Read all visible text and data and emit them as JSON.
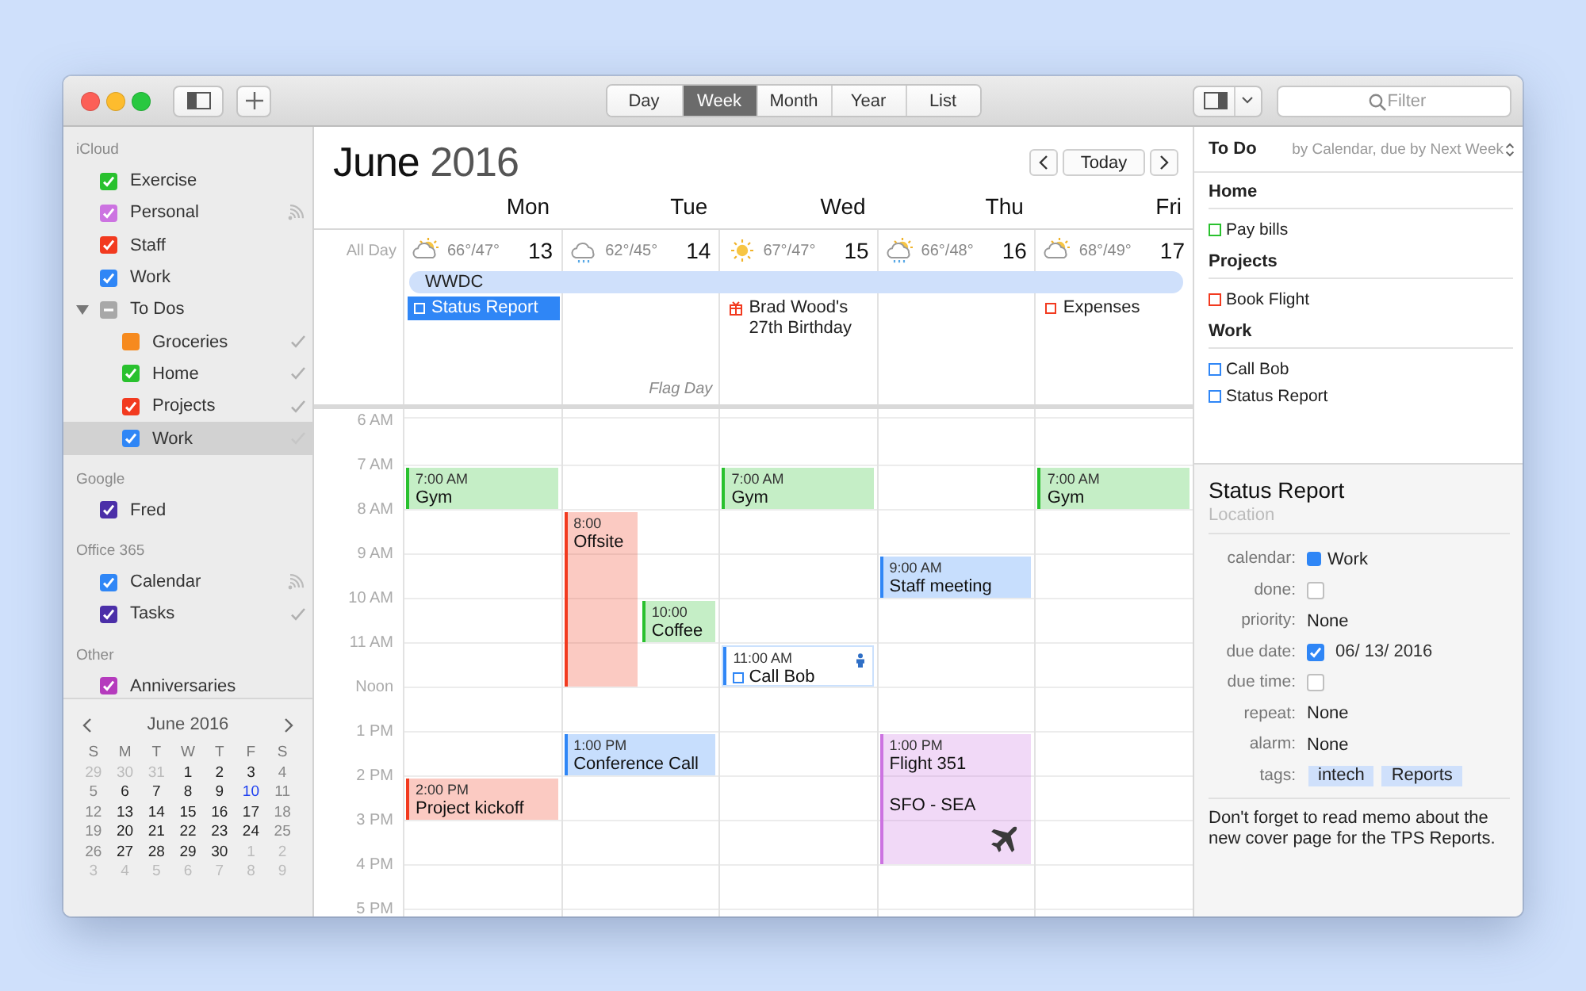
{
  "toolbar": {
    "view_tabs": [
      {
        "label": "Day",
        "selected": false
      },
      {
        "label": "Week",
        "selected": true
      },
      {
        "label": "Month",
        "selected": false
      },
      {
        "label": "Year",
        "selected": false
      },
      {
        "label": "List",
        "selected": false
      }
    ],
    "filter": {
      "placeholder": "Filter"
    }
  },
  "sidebar": {
    "sections": [
      {
        "title": "iCloud",
        "items": [
          {
            "label": "Exercise",
            "kind": "calendar",
            "color": "#29c12e",
            "checked": true,
            "selected": false,
            "shared": false,
            "completed_shown": false
          },
          {
            "label": "Personal",
            "kind": "calendar",
            "color": "#cc73e1",
            "checked": true,
            "selected": false,
            "shared": true,
            "completed_shown": false
          },
          {
            "label": "Staff",
            "kind": "calendar",
            "color": "#f23a1f",
            "checked": true,
            "selected": false,
            "shared": false,
            "completed_shown": false
          },
          {
            "label": "Work",
            "kind": "calendar",
            "color": "#2f86f6",
            "checked": true,
            "selected": false,
            "shared": false,
            "completed_shown": false
          },
          {
            "label": "To Dos",
            "kind": "group",
            "color": "#a8a8a8",
            "checked": true,
            "selected": false,
            "shared": false,
            "completed_shown": false,
            "expanded": true,
            "children": [
              {
                "label": "Groceries",
                "color": "#f68a1e",
                "checked": false,
                "selected": false,
                "shared": false,
                "completed_shown": true
              },
              {
                "label": "Home",
                "color": "#29c12e",
                "checked": true,
                "selected": false,
                "shared": false,
                "completed_shown": true
              },
              {
                "label": "Projects",
                "color": "#f23a1f",
                "checked": true,
                "selected": false,
                "shared": false,
                "completed_shown": true
              },
              {
                "label": "Work",
                "color": "#2f86f6",
                "checked": true,
                "selected": true,
                "shared": false,
                "completed_shown": true
              }
            ]
          }
        ]
      },
      {
        "title": "Google",
        "items": [
          {
            "label": "Fred",
            "kind": "calendar",
            "color": "#4b2fa8",
            "checked": true,
            "selected": false,
            "shared": false,
            "completed_shown": false
          }
        ]
      },
      {
        "title": "Office 365",
        "items": [
          {
            "label": "Calendar",
            "kind": "calendar",
            "color": "#2f86f6",
            "checked": true,
            "selected": false,
            "shared": true,
            "completed_shown": false
          },
          {
            "label": "Tasks",
            "kind": "calendar",
            "color": "#4b2fa8",
            "checked": true,
            "selected": false,
            "shared": false,
            "completed_shown": true
          }
        ]
      },
      {
        "title": "Other",
        "items": [
          {
            "label": "Anniversaries",
            "kind": "calendar",
            "color": "#b53bbd",
            "checked": true,
            "selected": false,
            "shared": false,
            "completed_shown": false
          }
        ]
      }
    ]
  },
  "mini_calendar": {
    "title": "June 2016",
    "weekdays": [
      "S",
      "M",
      "T",
      "W",
      "T",
      "F",
      "S"
    ],
    "weeks": [
      [
        {
          "label": "29",
          "outside_month": true,
          "today": false
        },
        {
          "label": "30",
          "outside_month": true,
          "today": false
        },
        {
          "label": "31",
          "outside_month": true,
          "today": false
        },
        {
          "label": "1",
          "outside_month": false,
          "today": false
        },
        {
          "label": "2",
          "outside_month": false,
          "today": false
        },
        {
          "label": "3",
          "outside_month": false,
          "today": false
        },
        {
          "label": "4",
          "outside_month": false,
          "today": false
        }
      ],
      [
        {
          "label": "5",
          "outside_month": false,
          "today": false
        },
        {
          "label": "6",
          "outside_month": false,
          "today": false
        },
        {
          "label": "7",
          "outside_month": false,
          "today": false
        },
        {
          "label": "8",
          "outside_month": false,
          "today": false
        },
        {
          "label": "9",
          "outside_month": false,
          "today": false
        },
        {
          "label": "10",
          "outside_month": false,
          "today": true
        },
        {
          "label": "11",
          "outside_month": false,
          "today": false
        }
      ],
      [
        {
          "label": "12",
          "outside_month": false,
          "today": false
        },
        {
          "label": "13",
          "outside_month": false,
          "today": false
        },
        {
          "label": "14",
          "outside_month": false,
          "today": false
        },
        {
          "label": "15",
          "outside_month": false,
          "today": false
        },
        {
          "label": "16",
          "outside_month": false,
          "today": false
        },
        {
          "label": "17",
          "outside_month": false,
          "today": false
        },
        {
          "label": "18",
          "outside_month": false,
          "today": false
        }
      ],
      [
        {
          "label": "19",
          "outside_month": false,
          "today": false
        },
        {
          "label": "20",
          "outside_month": false,
          "today": false
        },
        {
          "label": "21",
          "outside_month": false,
          "today": false
        },
        {
          "label": "22",
          "outside_month": false,
          "today": false
        },
        {
          "label": "23",
          "outside_month": false,
          "today": false
        },
        {
          "label": "24",
          "outside_month": false,
          "today": false
        },
        {
          "label": "25",
          "outside_month": false,
          "today": false
        }
      ],
      [
        {
          "label": "26",
          "outside_month": false,
          "today": false
        },
        {
          "label": "27",
          "outside_month": false,
          "today": false
        },
        {
          "label": "28",
          "outside_month": false,
          "today": false
        },
        {
          "label": "29",
          "outside_month": false,
          "today": false
        },
        {
          "label": "30",
          "outside_month": false,
          "today": false
        },
        {
          "label": "1",
          "outside_month": true,
          "today": false
        },
        {
          "label": "2",
          "outside_month": true,
          "today": false
        }
      ],
      [
        {
          "label": "3",
          "outside_month": true,
          "today": false
        },
        {
          "label": "4",
          "outside_month": true,
          "today": false
        },
        {
          "label": "5",
          "outside_month": true,
          "today": false
        },
        {
          "label": "6",
          "outside_month": true,
          "today": false
        },
        {
          "label": "7",
          "outside_month": true,
          "today": false
        },
        {
          "label": "8",
          "outside_month": true,
          "today": false
        },
        {
          "label": "9",
          "outside_month": true,
          "today": false
        }
      ]
    ]
  },
  "week": {
    "month": "June",
    "year": "2016",
    "today_button": "Today",
    "all_day_label": "All Day",
    "banner": {
      "label": "WWDC"
    },
    "hours": [
      "6 AM",
      "7 AM",
      "8 AM",
      "9 AM",
      "10 AM",
      "11 AM",
      "Noon",
      "1 PM",
      "2 PM",
      "3 PM",
      "4 PM",
      "5 PM"
    ],
    "days": [
      {
        "name": "Mon",
        "date": "13",
        "sun": true,
        "cloud": true,
        "rain": false,
        "temp": "66°/47°",
        "all_day": [
          {
            "kind": "todo",
            "label": "Status Report",
            "color": "#2f86f6",
            "selected": true
          }
        ],
        "events": [
          {
            "kind": "event",
            "time": "7:00 AM",
            "title": "Gym",
            "color": "#29c12e"
          },
          {
            "kind": "event",
            "time": "2:00 PM",
            "title": "Project kickoff",
            "color": "#f23a1f"
          }
        ]
      },
      {
        "name": "Tue",
        "date": "14",
        "sun": false,
        "cloud": true,
        "rain": true,
        "temp": "62°/45°",
        "holiday": "Flag Day",
        "events": [
          {
            "kind": "event",
            "time": "8:00",
            "title": "Offsite",
            "color": "#f23a1f"
          },
          {
            "kind": "event",
            "time": "10:00",
            "title": "Coffee",
            "color": "#29c12e"
          },
          {
            "kind": "event",
            "time": "1:00 PM",
            "title": "Conference Call",
            "color": "#2f86f6"
          }
        ]
      },
      {
        "name": "Wed",
        "date": "15",
        "sun": true,
        "cloud": false,
        "rain": false,
        "temp": "67°/47°",
        "all_day": [
          {
            "kind": "birthday",
            "label": "Brad Wood's 27th Birthday",
            "color": "#f23a1f",
            "selected": false
          }
        ],
        "events": [
          {
            "kind": "event",
            "time": "7:00 AM",
            "title": "Gym",
            "color": "#29c12e"
          },
          {
            "kind": "todo",
            "time": "11:00 AM",
            "title": "Call Bob",
            "color": "#2f86f6"
          }
        ]
      },
      {
        "name": "Thu",
        "date": "16",
        "sun": true,
        "cloud": true,
        "rain": true,
        "temp": "66°/48°",
        "events": [
          {
            "kind": "event",
            "time": "9:00 AM",
            "title": "Staff meeting",
            "color": "#2f86f6"
          },
          {
            "kind": "flight",
            "time": "1:00 PM",
            "title": "Flight 351",
            "note": "SFO - SEA",
            "color": "#cc73e1"
          }
        ]
      },
      {
        "name": "Fri",
        "date": "17",
        "sun": true,
        "cloud": true,
        "rain": false,
        "temp": "68°/49°",
        "all_day": [
          {
            "kind": "todo",
            "label": "Expenses",
            "color": "#f23a1f",
            "selected": false
          }
        ],
        "events": [
          {
            "kind": "event",
            "time": "7:00 AM",
            "title": "Gym",
            "color": "#29c12e"
          }
        ]
      }
    ]
  },
  "todo": {
    "title": "To Do",
    "sort": "by Calendar, due by Next Week",
    "groups": [
      {
        "name": "Home",
        "items": [
          {
            "label": "Pay bills",
            "color": "#29c12e",
            "done": false
          }
        ]
      },
      {
        "name": "Projects",
        "items": [
          {
            "label": "Book Flight",
            "color": "#f23a1f",
            "done": false
          }
        ]
      },
      {
        "name": "Work",
        "items": [
          {
            "label": "Call Bob",
            "color": "#2f86f6",
            "done": false
          },
          {
            "label": "Status Report",
            "color": "#2f86f6",
            "done": false
          }
        ]
      }
    ]
  },
  "details": {
    "title": "Status Report",
    "location_placeholder": "Location",
    "rows": [
      {
        "kind": "calendar",
        "label": "calendar:",
        "value": "Work",
        "color": "#2f86f6"
      },
      {
        "kind": "checkbox",
        "label": "done:",
        "checked": false
      },
      {
        "kind": "text",
        "label": "priority:",
        "value": "None"
      },
      {
        "kind": "date",
        "label": "due date:",
        "checked": true,
        "value": "06/ 13/ 2016"
      },
      {
        "kind": "checkbox",
        "label": "due time:",
        "checked": false
      },
      {
        "kind": "text",
        "label": "repeat:",
        "value": "None"
      },
      {
        "kind": "text",
        "label": "alarm:",
        "value": "None"
      },
      {
        "kind": "tags",
        "label": "tags:",
        "tags": [
          "intech",
          "Reports"
        ]
      }
    ],
    "note": "Don't forget to read memo about the new cover page for the TPS Reports."
  }
}
